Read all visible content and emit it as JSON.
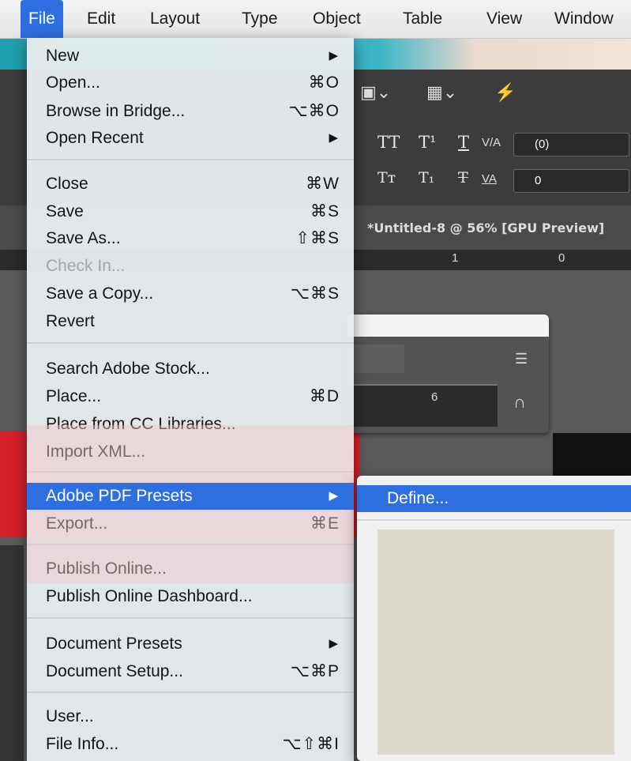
{
  "menubar": {
    "items": [
      "File",
      "Edit",
      "Layout",
      "Type",
      "Object",
      "Table",
      "View",
      "Window"
    ],
    "active_index": 0
  },
  "file_menu": {
    "groups": [
      [
        {
          "label": "New",
          "submenu": true
        },
        {
          "label": "Open...",
          "shortcut": "⌘O"
        },
        {
          "label": "Browse in Bridge...",
          "shortcut": "⌥⌘O"
        },
        {
          "label": "Open Recent",
          "submenu": true
        }
      ],
      [
        {
          "label": "Close",
          "shortcut": "⌘W"
        },
        {
          "label": "Save",
          "shortcut": "⌘S"
        },
        {
          "label": "Save As...",
          "shortcut": "⇧⌘S"
        },
        {
          "label": "Check In...",
          "disabled": true
        },
        {
          "label": "Save a Copy...",
          "shortcut": "⌥⌘S"
        },
        {
          "label": "Revert"
        }
      ],
      [
        {
          "label": "Search Adobe Stock..."
        },
        {
          "label": "Place...",
          "shortcut": "⌘D"
        },
        {
          "label": "Place from CC Libraries..."
        },
        {
          "label": "Import XML..."
        }
      ],
      [
        {
          "label": "Adobe PDF Presets",
          "submenu": true,
          "highlighted": true
        },
        {
          "label": "Export...",
          "shortcut": "⌘E"
        }
      ],
      [
        {
          "label": "Publish Online..."
        },
        {
          "label": "Publish Online Dashboard..."
        }
      ],
      [
        {
          "label": "Document Presets",
          "submenu": true
        },
        {
          "label": "Document Setup...",
          "shortcut": "⌥⌘P"
        }
      ],
      [
        {
          "label": "User..."
        },
        {
          "label": "File Info...",
          "shortcut": "⌥⇧⌘I"
        }
      ]
    ]
  },
  "submenu": {
    "items": [
      {
        "label": "Define..."
      }
    ]
  },
  "background": {
    "document_tab": "*Untitled-8 @ 56% [GPU Preview]",
    "ruler_marks": [
      "1",
      "0"
    ],
    "panel_ruler_mark": "6",
    "control_tracking": "(0)",
    "control_kerning": "0",
    "text_tt": "TT",
    "text_t_super": "T¹",
    "text_t_under": "T",
    "text_tt_small": "Tт",
    "text_t_sub": "T₁",
    "text_t_strike": "T"
  }
}
